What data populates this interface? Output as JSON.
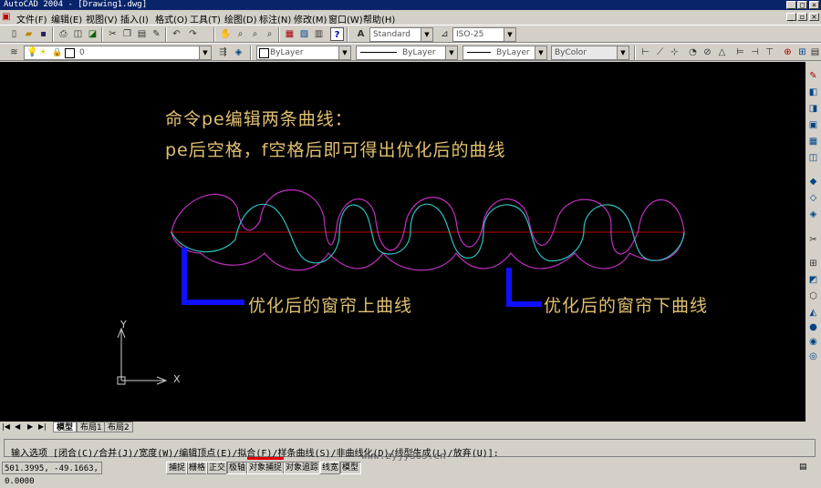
{
  "window": {
    "title": "AutoCAD 2004 - [Drawing1.dwg]",
    "controls": [
      "_",
      "□",
      "×"
    ]
  },
  "menubar": {
    "items": [
      "文件(F)",
      "编辑(E)",
      "视图(V)",
      "插入(I)",
      "格式(O)",
      "工具(T)",
      "绘图(D)",
      "标注(N)",
      "修改(M)",
      "窗口(W)",
      "帮助(H)"
    ]
  },
  "toolbars": {
    "text_style": "Standard",
    "dim_style": "ISO-25",
    "layer": "0",
    "color": "ByLayer",
    "linetype": "ByLayer",
    "lineweight": "ByLayer",
    "plotstyle": "ByColor"
  },
  "drawing": {
    "annotation_line1": "命令pe编辑两条曲线：",
    "annotation_line2": "pe后空格，f空格后即可得出优化后的曲线",
    "label_upper": "优化后的窗帘上曲线",
    "label_lower": "优化后的窗帘下曲线",
    "ucs_x": "X",
    "ucs_y": "Y",
    "colors": {
      "magenta_curve": "#c030c0",
      "cyan_curve": "#30c0c0",
      "red_line": "#c00000",
      "blue_leader": "#1010ff",
      "text": "#e0c070"
    }
  },
  "tabs": {
    "model": "模型",
    "layout1": "布局1",
    "layout2": "布局2"
  },
  "command": {
    "prompt": "输入选项 [闭合(C)/合并(J)/宽度(W)/编辑顶点(E)/拟合(F)/样条曲线(S)/非曲线化(D)/线型生成(L)/放弃(U)]:"
  },
  "status": {
    "coords": "501.3995, -49.1663, 0.0000",
    "buttons": [
      "捕捉",
      "栅格",
      "正交",
      "极轴",
      "对象捕捉",
      "对象追踪",
      "线宽",
      "模型"
    ]
  },
  "watermark": "www.zyjy365.cn"
}
